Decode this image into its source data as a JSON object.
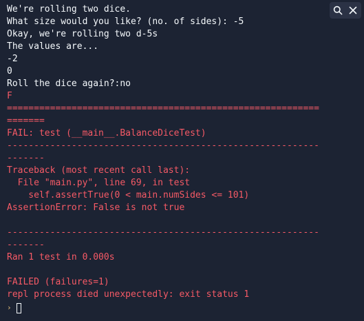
{
  "console": {
    "lines": [
      {
        "text": "We're rolling two dice.",
        "kind": "normal"
      },
      {
        "text": "What size would you like? (no. of sides): -5",
        "kind": "normal"
      },
      {
        "text": "Okay, we're rolling two d-5s",
        "kind": "normal"
      },
      {
        "text": "The values are...",
        "kind": "normal"
      },
      {
        "text": "-2",
        "kind": "normal"
      },
      {
        "text": "0",
        "kind": "normal"
      },
      {
        "text": "Roll the dice again?:no",
        "kind": "normal"
      },
      {
        "text": "F",
        "kind": "error"
      },
      {
        "text": "==========================================================",
        "kind": "error"
      },
      {
        "text": "=======",
        "kind": "error"
      },
      {
        "text": "FAIL: test (__main__.BalanceDiceTest)",
        "kind": "error"
      },
      {
        "text": "----------------------------------------------------------",
        "kind": "error"
      },
      {
        "text": "-------",
        "kind": "error"
      },
      {
        "text": "Traceback (most recent call last):",
        "kind": "error"
      },
      {
        "text": "  File \"main.py\", line 69, in test",
        "kind": "error"
      },
      {
        "text": "    self.assertTrue(0 < main.numSides <= 101)",
        "kind": "error"
      },
      {
        "text": "AssertionError: False is not true",
        "kind": "error"
      },
      {
        "text": "",
        "kind": "blank"
      },
      {
        "text": "----------------------------------------------------------",
        "kind": "error"
      },
      {
        "text": "-------",
        "kind": "error"
      },
      {
        "text": "Ran 1 test in 0.000s",
        "kind": "error"
      },
      {
        "text": "",
        "kind": "blank"
      },
      {
        "text": "FAILED (failures=1)",
        "kind": "error"
      },
      {
        "text": "repl process died unexpectedly: exit status 1",
        "kind": "error"
      }
    ],
    "prompt_symbol": "›"
  },
  "toolbar": {
    "search_icon": "search-icon",
    "close_icon": "close-icon"
  },
  "colors": {
    "background": "#1c2333",
    "normal_text": "#f5f9fc",
    "error_text": "#f65a66",
    "prompt": "#e5c07b"
  }
}
